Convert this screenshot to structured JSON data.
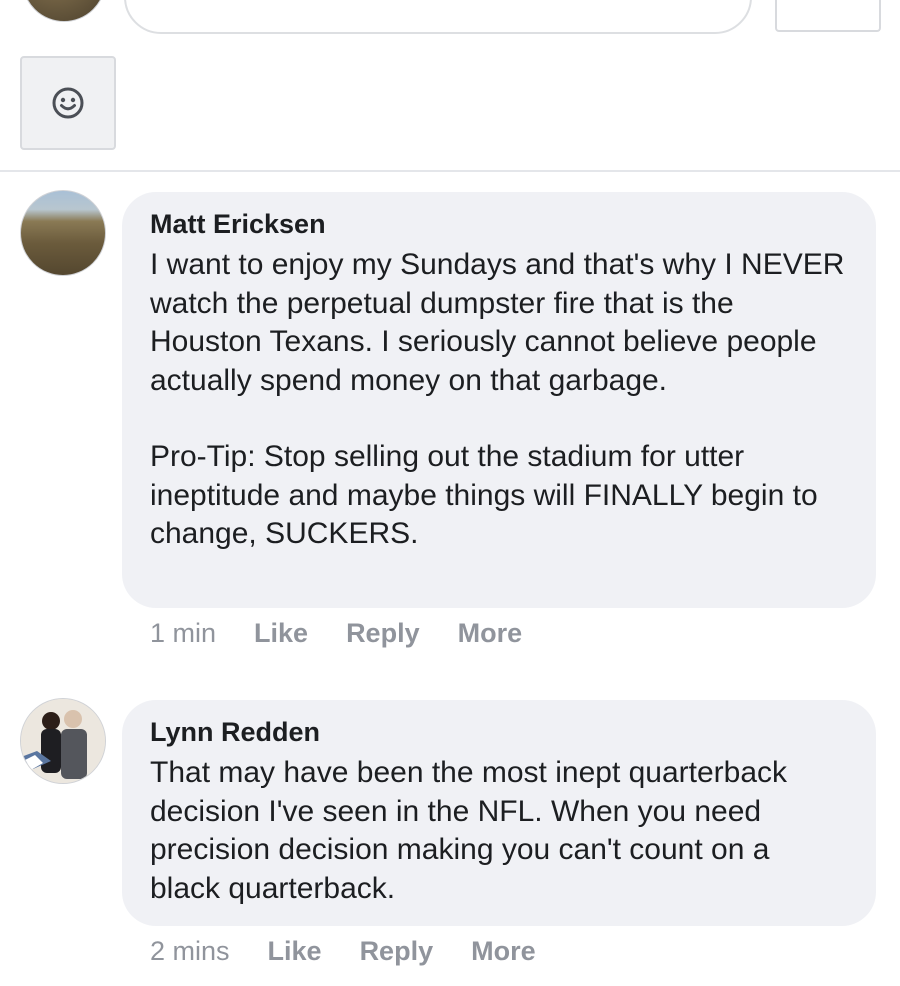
{
  "comments": [
    {
      "author": "Matt Ericksen",
      "paragraphs": [
        "I want to enjoy my Sundays and that's why I NEVER watch the perpetual dumpster fire that is the Houston Texans. I seriously cannot believe people actually spend money on that garbage.",
        "Pro-Tip: Stop selling out the stadium for utter ineptitude and maybe things will FINALLY begin to change, SUCKERS."
      ],
      "time": "1 min",
      "like": "Like",
      "reply": "Reply",
      "more": "More"
    },
    {
      "author": "Lynn Redden",
      "paragraphs": [
        "That may have been the most inept quarterback decision I've seen in the NFL. When you need precision decision making you can't count on a black quarterback."
      ],
      "time": "2 mins",
      "like": "Like",
      "reply": "Reply",
      "more": "More"
    }
  ],
  "icons": {
    "emoji": "smiley-face-icon"
  },
  "colors": {
    "bubble": "#f0f1f5",
    "meta_text": "#90949c",
    "text": "#1c1e21"
  }
}
